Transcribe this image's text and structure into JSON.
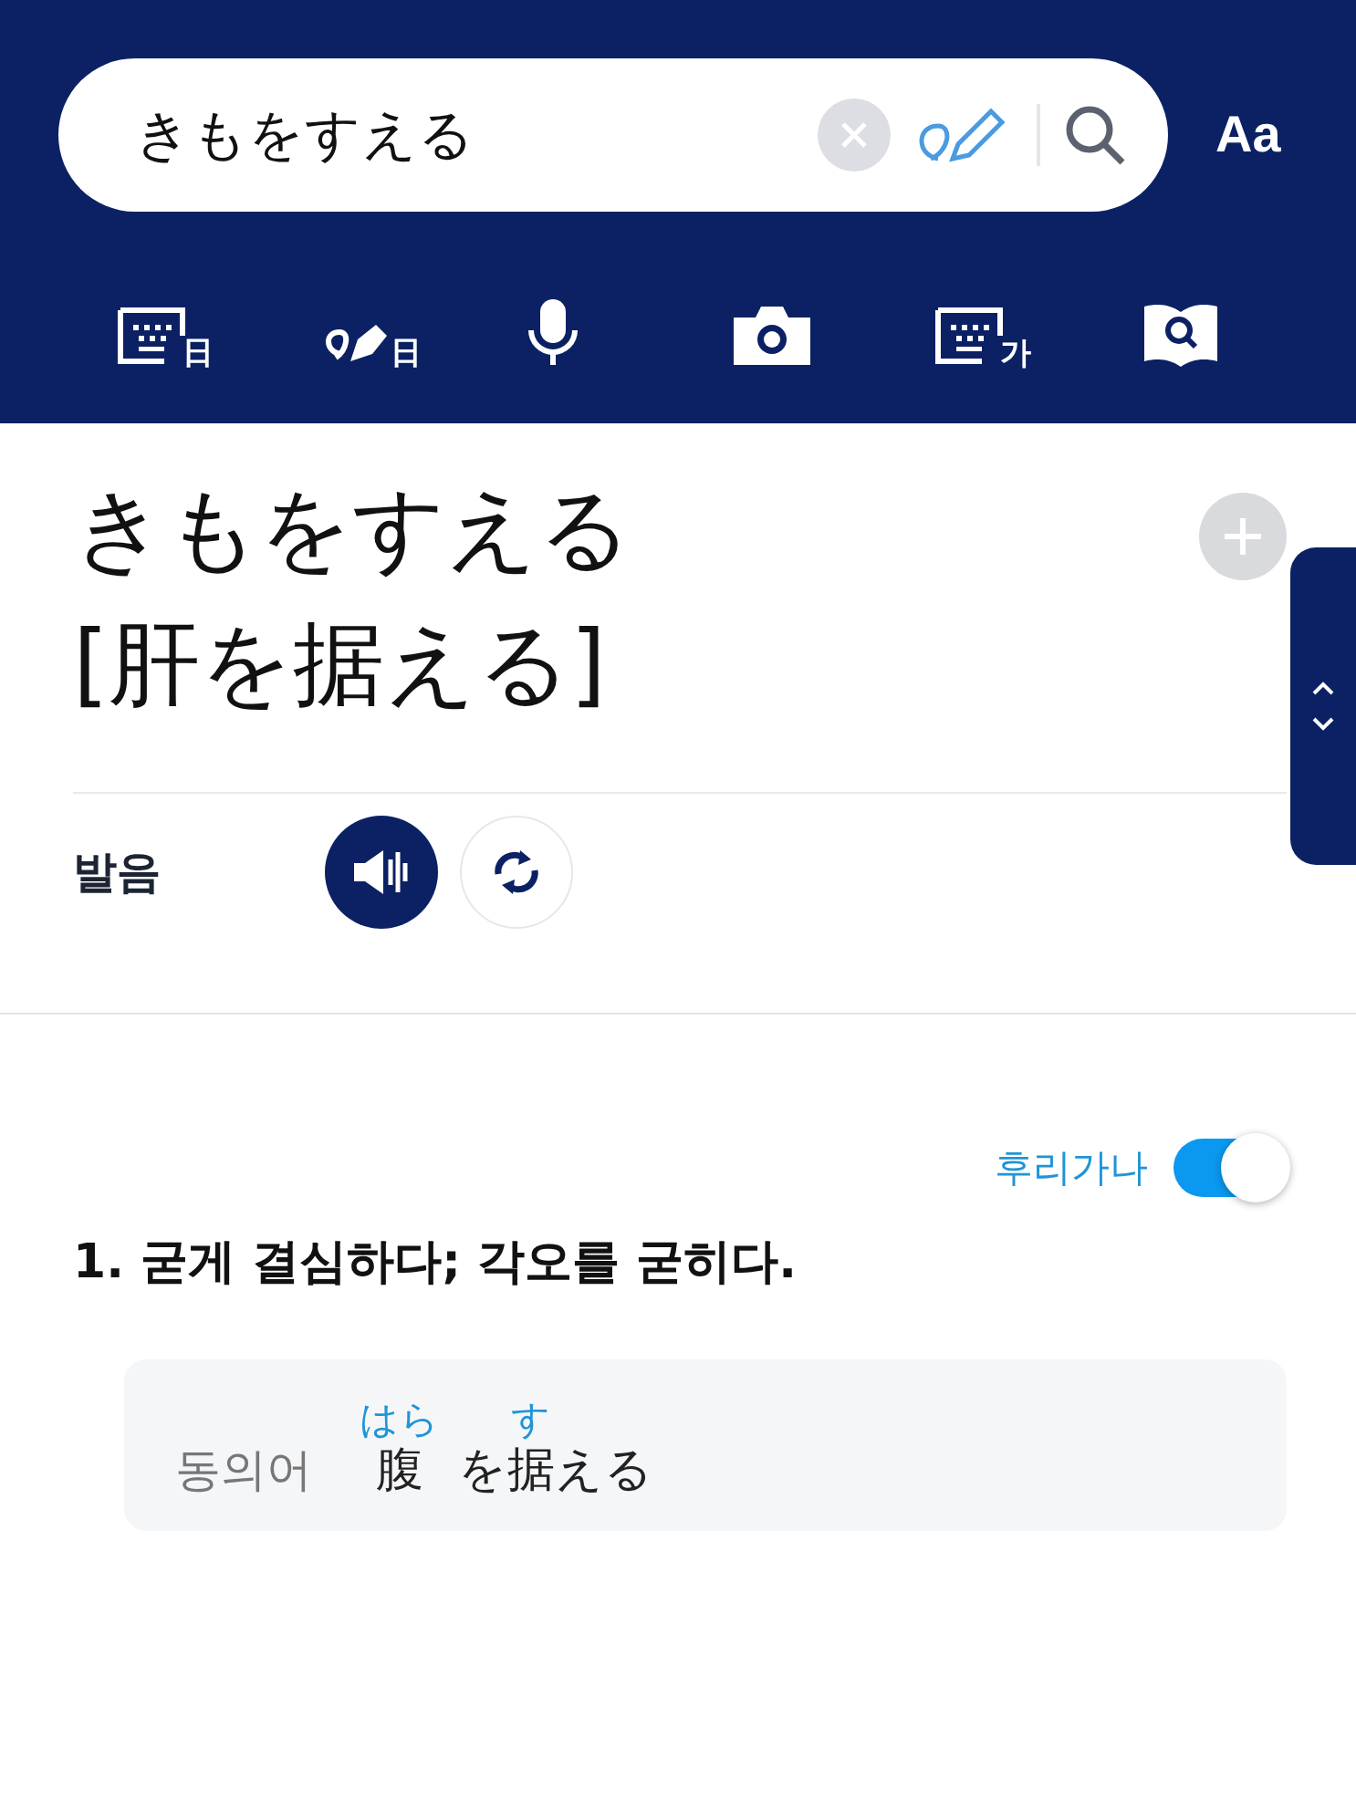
{
  "search": {
    "value": "きもをすえる",
    "font_button": "Aa"
  },
  "tools": [
    {
      "kind": "keyboard",
      "badge": "日"
    },
    {
      "kind": "handwriting",
      "badge": "日"
    },
    {
      "kind": "voice"
    },
    {
      "kind": "camera"
    },
    {
      "kind": "keyboard",
      "badge": "가"
    },
    {
      "kind": "book-search"
    }
  ],
  "entry": {
    "reading": "きもをすえる",
    "headword": "[肝を据える]"
  },
  "pronunciation": {
    "label": "발음"
  },
  "furigana": {
    "label": "후리가나",
    "on": true
  },
  "senses": [
    {
      "text": "1. 굳게 결심하다; 각오를 굳히다.",
      "synonym": {
        "label": "동의어",
        "segments": [
          {
            "text": "腹",
            "ruby": "はら"
          },
          {
            "text": "を"
          },
          {
            "text": "据",
            "ruby": "す"
          },
          {
            "text": "える"
          }
        ]
      }
    }
  ]
}
